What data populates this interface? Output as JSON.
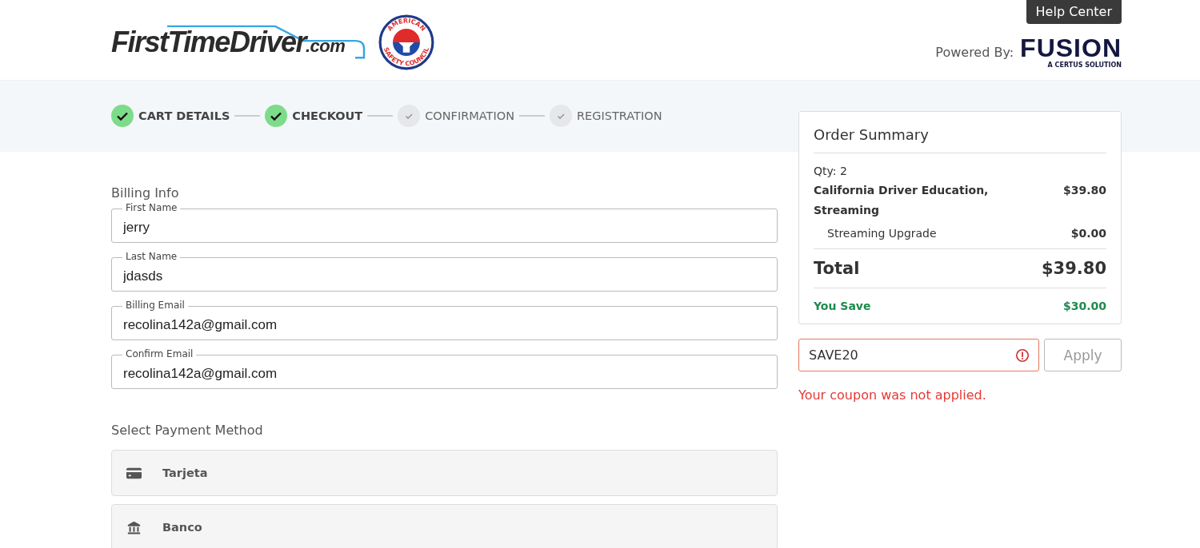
{
  "header": {
    "logo": {
      "name": "FirstTime",
      "accent": "Driver",
      "suffix": ".com"
    },
    "seal": {
      "top": "AMERICAN",
      "bottom": "SAFETY COUNCIL"
    },
    "help_button": "Help Center",
    "powered_by": "Powered By:",
    "partner": {
      "name": "FUSION",
      "tagline": "A CERTUS SOLUTION"
    }
  },
  "steps": [
    {
      "label": "CART DETAILS",
      "done": true
    },
    {
      "label": "CHECKOUT",
      "done": true
    },
    {
      "label": "CONFIRMATION",
      "done": false
    },
    {
      "label": "REGISTRATION",
      "done": false
    }
  ],
  "billing": {
    "title": "Billing Info",
    "fields": [
      {
        "label": "First Name",
        "value": "jerry"
      },
      {
        "label": "Last Name",
        "value": "jdasds"
      },
      {
        "label": "Billing Email",
        "value": "recolina142a@gmail.com"
      },
      {
        "label": "Confirm Email",
        "value": "recolina142a@gmail.com"
      }
    ]
  },
  "payment": {
    "title": "Select Payment Method",
    "methods": [
      {
        "kind": "card",
        "label": "Tarjeta"
      },
      {
        "kind": "bank",
        "label": "Banco"
      }
    ]
  },
  "order_summary": {
    "title": "Order Summary",
    "qty": "Qty: 2",
    "items": [
      {
        "kind": "product",
        "name": "California Driver Education, Streaming",
        "price": "$39.80"
      },
      {
        "kind": "addon",
        "name": "Streaming Upgrade",
        "price": "$0.00"
      }
    ],
    "total_label": "Total",
    "total": "$39.80",
    "save_label": "You Save",
    "save": "$30.00"
  },
  "coupon": {
    "value": "SAVE20",
    "error": true,
    "button": "Apply",
    "message": "Your coupon was not applied."
  }
}
